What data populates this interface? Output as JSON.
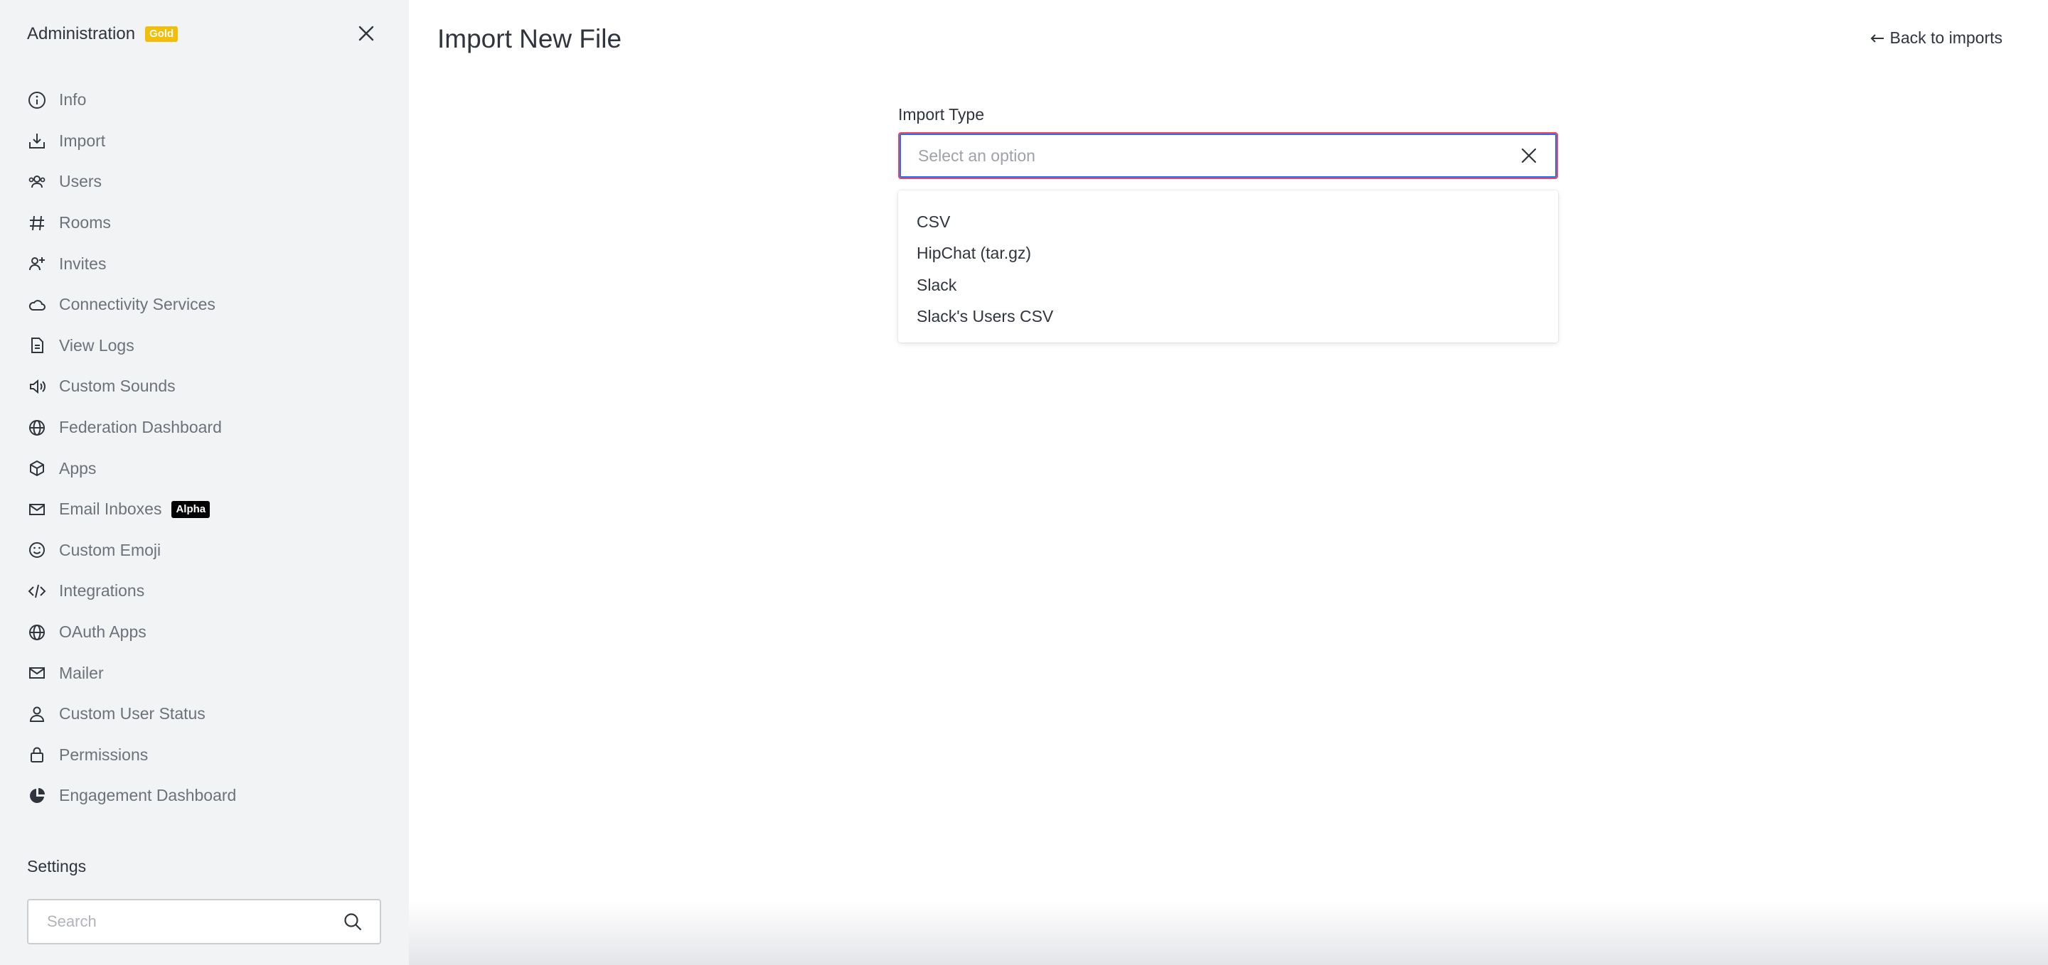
{
  "sidebar": {
    "title": "Administration",
    "badge": "Gold",
    "items": [
      {
        "label": "Info",
        "icon": "info-icon"
      },
      {
        "label": "Import",
        "icon": "import-icon"
      },
      {
        "label": "Users",
        "icon": "users-icon"
      },
      {
        "label": "Rooms",
        "icon": "hashtag-icon"
      },
      {
        "label": "Invites",
        "icon": "user-plus-icon"
      },
      {
        "label": "Connectivity Services",
        "icon": "cloud-icon"
      },
      {
        "label": "View Logs",
        "icon": "file-icon"
      },
      {
        "label": "Custom Sounds",
        "icon": "speaker-icon"
      },
      {
        "label": "Federation Dashboard",
        "icon": "globe-icon"
      },
      {
        "label": "Apps",
        "icon": "cube-icon"
      },
      {
        "label": "Email Inboxes",
        "icon": "mail-icon",
        "badge": "Alpha"
      },
      {
        "label": "Custom Emoji",
        "icon": "emoji-icon"
      },
      {
        "label": "Integrations",
        "icon": "code-icon"
      },
      {
        "label": "OAuth Apps",
        "icon": "globe-icon"
      },
      {
        "label": "Mailer",
        "icon": "mail-icon"
      },
      {
        "label": "Custom User Status",
        "icon": "user-icon"
      },
      {
        "label": "Permissions",
        "icon": "lock-icon"
      },
      {
        "label": "Engagement Dashboard",
        "icon": "pie-chart-icon"
      }
    ],
    "settings_title": "Settings",
    "search_placeholder": "Search"
  },
  "main": {
    "title": "Import New File",
    "back_label": "Back to imports",
    "field_label": "Import Type",
    "select_placeholder": "Select an option",
    "options": [
      "CSV",
      "HipChat (tar.gz)",
      "Slack",
      "Slack's Users CSV"
    ]
  },
  "colors": {
    "gold_badge": "#f3be08",
    "focus_ring": "#1d74f5",
    "error_border": "#f5455c",
    "sidebar_bg": "#f2f3f5"
  }
}
